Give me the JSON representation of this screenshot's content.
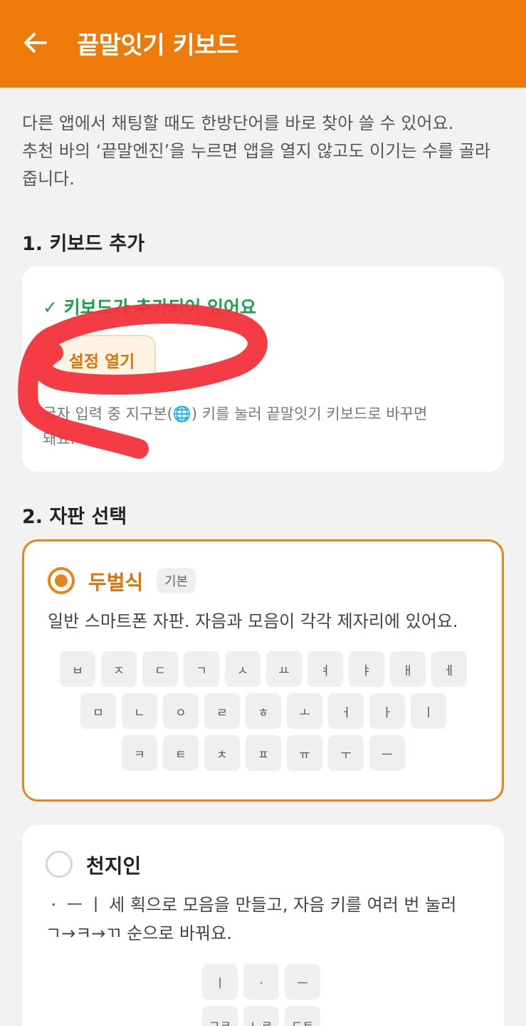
{
  "header": {
    "title": "끝말잇기 키보드",
    "back_icon": "arrow-left-icon"
  },
  "intro": {
    "line1": "다른 앱에서 채팅할 때도 한방단어를 바로 찾아 쓸 수 있어요.",
    "line2": "추천 바의 ‘끝말엔진’을 누르면 앱을 열지 않고도 이기는 수를 골라",
    "line3": "줍니다."
  },
  "section1": {
    "title": "1. 키보드 추가",
    "status": "✓ 키보드가 추가되어 있어요",
    "button": "설정 열기",
    "hint_line1": "글자 입력 중 지구본(🌐) 키를 눌러 끝말잇기 키보드로 바꾸면",
    "hint_line2": "돼요."
  },
  "section2": {
    "title": "2. 자판 선택",
    "option1": {
      "name": "두벌식",
      "badge": "기본",
      "desc": "일반 스마트폰 자판. 자음과 모음이 각각 제자리에 있어요.",
      "selected": true,
      "rows": [
        [
          "ㅂ",
          "ㅈ",
          "ㄷ",
          "ㄱ",
          "ㅅ",
          "ㅛ",
          "ㅕ",
          "ㅑ",
          "ㅐ",
          "ㅔ"
        ],
        [
          "ㅁ",
          "ㄴ",
          "ㅇ",
          "ㄹ",
          "ㅎ",
          "ㅗ",
          "ㅓ",
          "ㅏ",
          "ㅣ"
        ],
        [
          "ㅋ",
          "ㅌ",
          "ㅊ",
          "ㅍ",
          "ㅠ",
          "ㅜ",
          "ㅡ"
        ]
      ]
    },
    "option2": {
      "name": "천지인",
      "desc_line1": "ㆍ ㅡ ㅣ 세 획으로 모음을 만들고, 자음 키를 여러 번 눌러",
      "desc_line2": "ㄱ→ㅋ→ㄲ 순으로 바꿔요.",
      "selected": false,
      "rows": [
        [
          "ㅣ",
          "ㆍ",
          "ㅡ"
        ],
        [
          "ㄱㅋ",
          "ㄴㄹ",
          "ㄷㅌ"
        ]
      ]
    }
  },
  "colors": {
    "accent": "#ee7a0a",
    "success": "#17a34a",
    "annotation": "#f2323a"
  }
}
